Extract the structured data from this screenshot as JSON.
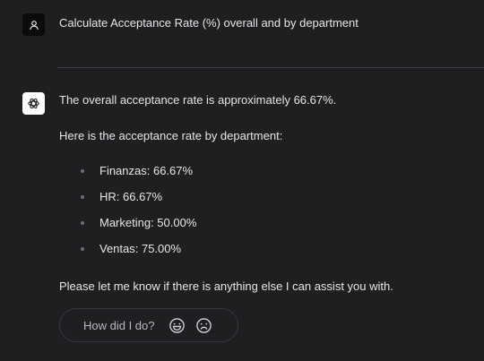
{
  "user_message": {
    "text": "Calculate Acceptance Rate (%) overall and by department",
    "avatar_icon": "user-icon"
  },
  "assistant_message": {
    "avatar_icon": "openai-logo-icon",
    "intro": "The overall acceptance rate is approximately 66.67%.",
    "lead_in": "Here is the acceptance rate by department:",
    "departments": [
      "Finanzas: 66.67%",
      "HR: 66.67%",
      "Marketing: 50.00%",
      "Ventas: 75.00%"
    ],
    "closing": "Please let me know if there is anything else I can assist you with."
  },
  "feedback": {
    "label": "How did I do?",
    "positive_icon": "smile-icon",
    "negative_icon": "frown-icon"
  },
  "colors": {
    "background": "#1f1e21",
    "text": "#e6e6e8",
    "muted": "#b9b8bd"
  }
}
